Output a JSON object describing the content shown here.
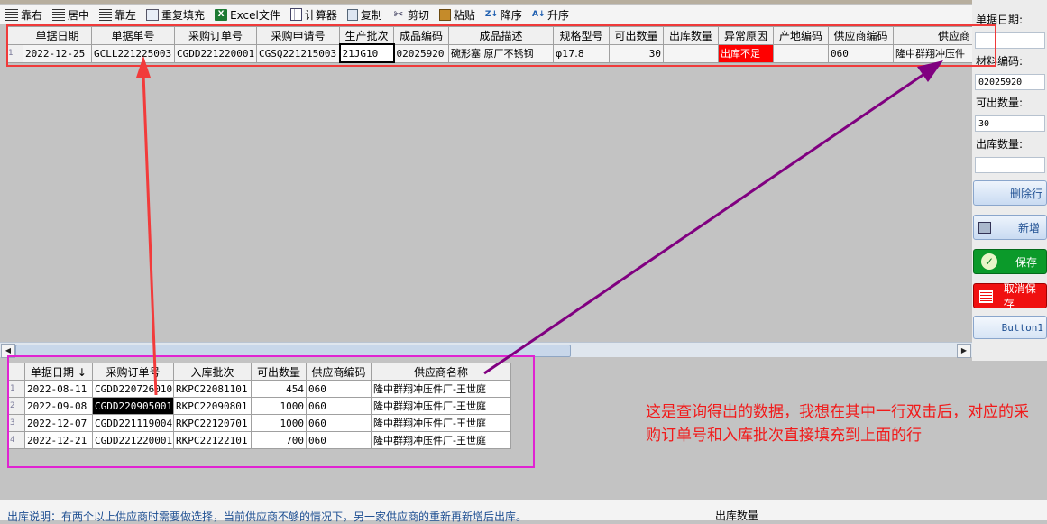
{
  "toolbar": {
    "items": [
      {
        "label": "靠右",
        "icon": "align-right-icon"
      },
      {
        "label": "居中",
        "icon": "align-center-icon"
      },
      {
        "label": "靠左",
        "icon": "align-left-icon"
      },
      {
        "label": "重复填充",
        "icon": "repeat-fill-icon"
      },
      {
        "label": "Excel文件",
        "icon": "excel-icon"
      },
      {
        "label": "计算器",
        "icon": "calculator-icon"
      },
      {
        "label": "复制",
        "icon": "copy-icon"
      },
      {
        "label": "剪切",
        "icon": "scissors-icon"
      },
      {
        "label": "粘贴",
        "icon": "paste-icon"
      },
      {
        "label": "降序",
        "icon": "sort-desc-icon"
      },
      {
        "label": "升序",
        "icon": "sort-asc-icon"
      }
    ]
  },
  "top_grid": {
    "headers": [
      "单据日期",
      "单据单号",
      "采购订单号",
      "采购申请号",
      "生产批次",
      "成品编码",
      "成品描述",
      "规格型号",
      "可出数量",
      "出库数量",
      "异常原因",
      "产地编码",
      "供应商编码",
      "供应商"
    ],
    "rows": [
      {
        "n": "1",
        "cells": [
          "2022-12-25",
          "GCLL221225003",
          "CGDD221220001",
          "CGSQ221215003",
          "21JG10",
          "02025920",
          "碗形塞 原厂不锈钢",
          "φ17.8",
          "30",
          "",
          "出库不足",
          "",
          "060",
          "隆中群翔冲压件"
        ]
      }
    ]
  },
  "bottom_grid": {
    "headers": [
      "单据日期",
      "采购订单号",
      "入库批次",
      "可出数量",
      "供应商编码",
      "供应商名称"
    ],
    "sort_indicator": "↓",
    "rows": [
      {
        "n": "1",
        "cells": [
          "2022-08-11",
          "CGDD220726010",
          "RKPC22081101",
          "454",
          "060",
          "隆中群翔冲压件厂-王世庭"
        ]
      },
      {
        "n": "2",
        "cells": [
          "2022-09-08",
          "CGDD220905001",
          "RKPC22090801",
          "1000",
          "060",
          "隆中群翔冲压件厂-王世庭"
        ]
      },
      {
        "n": "3",
        "cells": [
          "2022-12-07",
          "CGDD221119004",
          "RKPC22120701",
          "1000",
          "060",
          "隆中群翔冲压件厂-王世庭"
        ]
      },
      {
        "n": "4",
        "cells": [
          "2022-12-21",
          "CGDD221220001",
          "RKPC22122101",
          "700",
          "060",
          "隆中群翔冲压件厂-王世庭"
        ]
      }
    ]
  },
  "right_panel": {
    "doc_date_label": "单据日期:",
    "doc_date_value": "",
    "material_code_label": "材料编码:",
    "material_code_value": "02025920",
    "available_qty_label": "可出数量:",
    "available_qty_value": "30",
    "out_qty_label": "出库数量:",
    "out_qty_value": "",
    "delete_row_label": "删除行",
    "add_label": "新增",
    "save_label": "保存",
    "cancel_save_label": "取消保存",
    "button1_label": "Button1"
  },
  "annotation": {
    "text": "这是查询得出的数据，我想在其中一行双击后，对应的采购订单号和入库批次直接填充到上面的行",
    "color": "#f11a1a"
  },
  "status": {
    "note": "出库说明：有两个以上供应商时需要做选择，当前供应商不够的情况下，另一家供应商的重新再新增后出库。",
    "out_qty_label": "出库数量"
  },
  "colors": {
    "error_bg": "#ff0000",
    "highlight_box_top": "#f03a3a",
    "highlight_box_bottom": "#e023d2",
    "arrow_purple": "#800080"
  }
}
